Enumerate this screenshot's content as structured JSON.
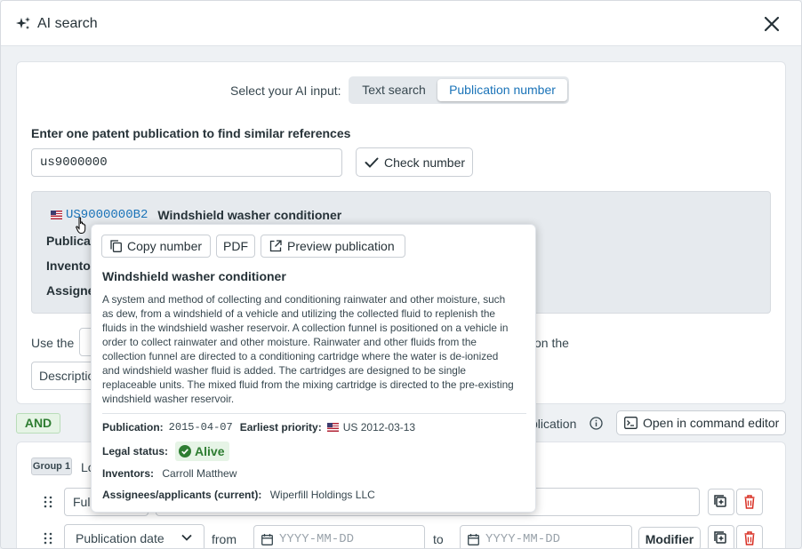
{
  "header": {
    "title": "AI search",
    "icon": "sparkle-icon",
    "close_icon": "close-icon"
  },
  "input_selector": {
    "label": "Select your AI input:",
    "options": [
      "Text search",
      "Publication number"
    ],
    "selected": "Publication number"
  },
  "publication_input": {
    "label": "Enter one patent publication to find similar references",
    "value": "us9000000",
    "check_button": "Check number"
  },
  "result": {
    "number": "US9000000B2",
    "title": "Windshield washer conditioner",
    "field_labels": [
      "Publicat",
      "Inventor",
      "Assigne"
    ]
  },
  "use_the": {
    "prefix": "Use the",
    "suffix": "on the",
    "select_value": "Descriptio"
  },
  "operator": {
    "and_label": "AND",
    "publication_label": "blication",
    "command_editor_button": "Open in command editor"
  },
  "group": {
    "tag": "Group 1",
    "label_partial": "Lo",
    "row1_select": "Full",
    "row2_select": "Publication date",
    "from_label": "from",
    "to_label": "to",
    "date_placeholder_from": "YYYY-MM-DD",
    "date_placeholder_to": "YYYY-MM-DD",
    "modifier_button": "Modifier"
  },
  "popover": {
    "copy_button": "Copy number",
    "pdf_button": "PDF",
    "preview_button": "Preview publication",
    "title": "Windshield washer conditioner",
    "abstract_lines": [
      "A system and method of collecting and conditioning rainwater and other moisture, such",
      "as dew, from a windshield of a vehicle and utilizing the collected fluid to replenish the",
      "fluids in the windshield washer reservoir. A collection funnel is positioned on a vehicle in",
      "order to collect rainwater and other moisture. Rainwater and other fluids from the",
      "collection funnel are directed to a conditioning cartridge where the water is de-ionized",
      "and windshield washer fluid is added. The cartridges are designed to be single",
      "replaceable units. The mixed fluid from the mixing cartridge is directed to the pre-existing",
      "windshield washer reservoir."
    ],
    "publication_label": "Publication:",
    "publication_date": "2015-04-07",
    "priority_label": "Earliest priority:",
    "priority_value": "US 2012-03-13",
    "legal_status_label": "Legal status:",
    "legal_status_value": "Alive",
    "inventors_label": "Inventors:",
    "inventors_value": "Carroll Matthew",
    "assignees_label": "Assignees/applicants (current):",
    "assignees_value": "Wiperfill Holdings LLC"
  },
  "colors": {
    "accent": "#1a73b8",
    "success": "#2e7d32",
    "danger": "#d93025",
    "background": "#eef1f4"
  }
}
